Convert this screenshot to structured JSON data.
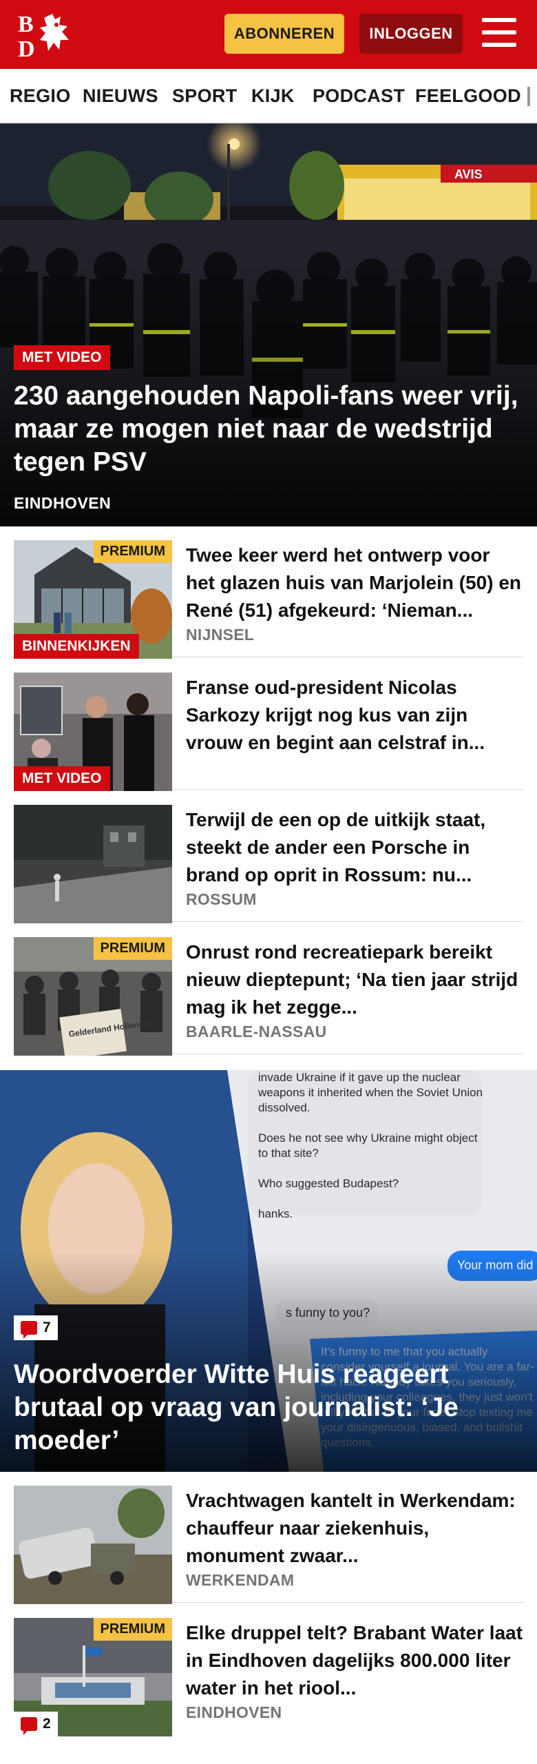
{
  "header": {
    "logo_text": "BD",
    "subscribe_label": "ABONNEREN",
    "login_label": "INLOGGEN",
    "brand_color": "#d10a11",
    "accent_color": "#f6c244"
  },
  "nav": {
    "items": [
      "REGIO",
      "NIEUWS",
      "SPORT",
      "KIJK",
      "PODCAST",
      "FEELGOOD"
    ]
  },
  "hero": {
    "badge": "MET VIDEO",
    "title": "230 aangehouden Napoli-fans weer vrij, maar ze mogen niet naar de wedstrijd tegen PSV",
    "location": "EINDHOVEN"
  },
  "articles": [
    {
      "title": "Twee keer werd het ontwerp voor het glazen huis van Marjolein (50) en René (51) afgekeurd: ‘Nieman...",
      "location": "NIJNSEL",
      "premium_label": "PREMIUM",
      "badge": "BINNENKIJKEN"
    },
    {
      "title": "Franse oud-president Nicolas Sarkozy krijgt nog kus van zijn vrouw en begint aan celstraf in...",
      "badge": "MET VIDEO"
    },
    {
      "title": "Terwijl de een op de uitkijk staat, steekt de ander een Porsche in brand op oprit in Rossum: nu...",
      "location": "ROSSUM"
    },
    {
      "title": "Onrust rond recreatiepark bereikt nieuw dieptepunt; ‘Na tien jaar strijd mag ik het zegge...",
      "location": "BAARLE-NASSAU",
      "premium_label": "PREMIUM",
      "thumb_text": "Gelderland Hollander"
    }
  ],
  "feature": {
    "comment_count": "7",
    "title": "Woordvoerder Witte Huis reageert brutaal op vraag van journalist: ‘Je moeder’",
    "chat": {
      "line1": "invade Ukraine if it gave up the nuclear weapons it inherited when the Soviet Union dissolved.",
      "line2": "Does he not see why Ukraine might object to that site?",
      "line3": "Who suggested Budapest?",
      "line4": "hanks.",
      "blue1": "Your mom did",
      "grey2": "s funny to you?",
      "blue2": "It's funny to me that you actually consider yourself a journal. You are a far-left hack. Nobody takes you seriously, including your colleagues, they just won't tell you that to your face. Stop texting me your disingenuous, biased, and bullshit questions."
    }
  },
  "articles2": [
    {
      "title": "Vrachtwagen kantelt in Werkendam: chauffeur naar ziekenhuis, monument zwaar...",
      "location": "WERKENDAM"
    },
    {
      "title": "Elke druppel telt? Brabant Water laat in Eindhoven dagelijks 800.000 liter water in het riool...",
      "location": "EINDHOVEN",
      "premium_label": "PREMIUM",
      "comment_count": "2"
    }
  ]
}
